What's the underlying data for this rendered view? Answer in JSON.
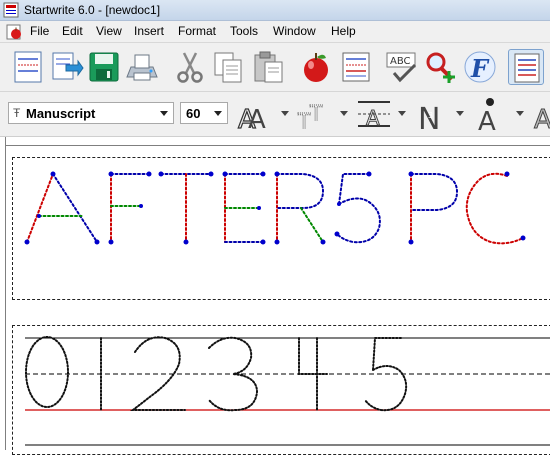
{
  "window": {
    "title": "Startwrite 6.0 - [newdoc1]"
  },
  "menubar": {
    "items": [
      "File",
      "Edit",
      "View",
      "Insert",
      "Format",
      "Tools",
      "Window",
      "Help"
    ]
  },
  "toolbar_icons": [
    "new-document-icon",
    "open-folder-icon",
    "save-disk-icon",
    "print-icon",
    "cut-scissors-icon",
    "copy-icon",
    "paste-icon",
    "apple-icon",
    "page-lines-icon",
    "spell-check-icon",
    "find-replace-icon",
    "font-f-icon",
    "guide-lines-icon"
  ],
  "format": {
    "font": "Manuscript",
    "size": "60"
  },
  "document": {
    "line1": "AFTER5 PC",
    "line2": "012345"
  },
  "colors": {
    "title_bg": "#c4d5ea",
    "toolbar_bg": "#f0f0f0",
    "dot_blue": "#0000cc",
    "stroke_red": "#cc0000",
    "stroke_green": "#008800",
    "stroke_blue": "#0000aa",
    "guide_red": "#cc0000"
  }
}
